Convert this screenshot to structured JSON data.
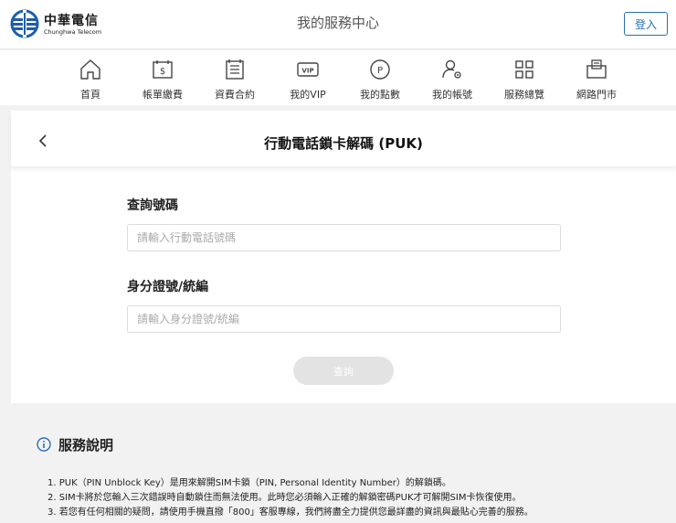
{
  "header": {
    "logo_zh": "中華電信",
    "logo_en": "Chunghwa Telecom",
    "title": "我的服務中心",
    "login_label": "登入"
  },
  "nav": [
    {
      "label": "首頁",
      "icon": "home-icon"
    },
    {
      "label": "帳單繳費",
      "icon": "bill-icon"
    },
    {
      "label": "資費合約",
      "icon": "contract-icon"
    },
    {
      "label": "我的VIP",
      "icon": "vip-icon"
    },
    {
      "label": "我的點數",
      "icon": "points-icon"
    },
    {
      "label": "我的帳號",
      "icon": "account-settings-icon"
    },
    {
      "label": "服務總覽",
      "icon": "grid-icon"
    },
    {
      "label": "網路門市",
      "icon": "shopping-bag-icon"
    }
  ],
  "form": {
    "title": "行動電話鎖卡解碼 (PUK)",
    "phone_label": "查詢號碼",
    "phone_placeholder": "請輸入行動電話號碼",
    "phone_value": "",
    "id_label": "身分證號/統編",
    "id_placeholder": "請輸入身分證號/統編",
    "id_value": "",
    "submit_label": "查詢"
  },
  "info": {
    "title": "服務說明",
    "items": [
      "1. PUK（PIN Unblock Key）是用來解開SIM卡鎖（PIN, Personal Identity Number）的解鎖碼。",
      "2. SIM卡將於您輸入三次錯誤時自動鎖住而無法使用。此時您必須輸入正確的解鎖密碼PUK才可解開SIM卡恢復使用。",
      "3. 若您有任何相關的疑問，請使用手機直撥「800」客服專線，我們將盡全力提供您最詳盡的資訊與最貼心完善的服務。"
    ]
  },
  "colors": {
    "brand_blue": "#2a6fb0",
    "logo_blue": "#1f5fa8",
    "button_disabled": "#e3e3e3",
    "page_bg": "#f2f2f2"
  }
}
